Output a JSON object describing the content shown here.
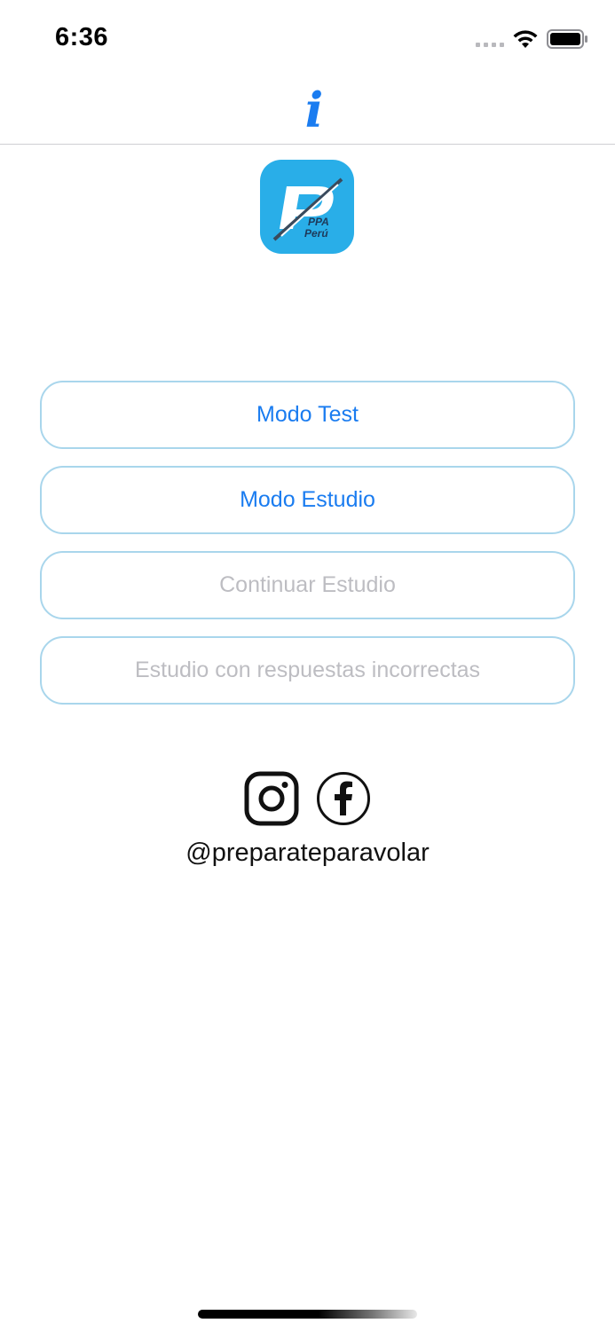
{
  "status_bar": {
    "time": "6:36"
  },
  "icons": {
    "info": "info-icon",
    "signal": "cellular-signal-icon",
    "wifi": "wifi-icon",
    "battery": "battery-icon",
    "instagram": "instagram-icon",
    "facebook": "facebook-icon"
  },
  "nav": {
    "info_glyph": "i"
  },
  "logo": {
    "letter": "P",
    "text_line1": "PPA",
    "text_line2": "Perú"
  },
  "menu": {
    "buttons": [
      {
        "label": "Modo Test",
        "enabled": true
      },
      {
        "label": "Modo Estudio",
        "enabled": true
      },
      {
        "label": "Continuar Estudio",
        "enabled": false
      },
      {
        "label": "Estudio con respuestas incorrectas",
        "enabled": false
      }
    ]
  },
  "social": {
    "handle": "@preparateparavolar"
  },
  "colors": {
    "accent": "#1a7cf0",
    "button_border": "#a9d6ec",
    "disabled_text": "#bdbdc2",
    "logo_background": "#29aee8"
  }
}
